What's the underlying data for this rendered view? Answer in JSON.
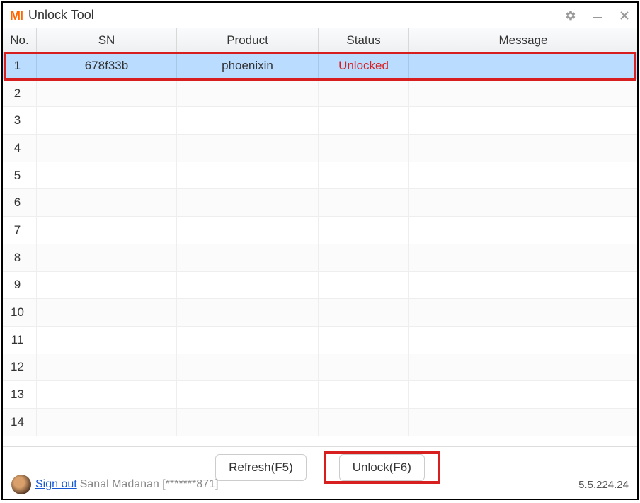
{
  "titlebar": {
    "logo": "MI",
    "title": "Unlock Tool",
    "icons": {
      "settings": "gear",
      "minimize": "minimize",
      "close": "close"
    }
  },
  "table": {
    "headers": {
      "no": "No.",
      "sn": "SN",
      "product": "Product",
      "status": "Status",
      "message": "Message"
    },
    "rows": [
      {
        "no": "1",
        "sn": "678f33b",
        "product": "phoenixin",
        "status": "Unlocked",
        "message": "",
        "highlighted": true
      },
      {
        "no": "2",
        "sn": "",
        "product": "",
        "status": "",
        "message": ""
      },
      {
        "no": "3",
        "sn": "",
        "product": "",
        "status": "",
        "message": ""
      },
      {
        "no": "4",
        "sn": "",
        "product": "",
        "status": "",
        "message": ""
      },
      {
        "no": "5",
        "sn": "",
        "product": "",
        "status": "",
        "message": ""
      },
      {
        "no": "6",
        "sn": "",
        "product": "",
        "status": "",
        "message": ""
      },
      {
        "no": "7",
        "sn": "",
        "product": "",
        "status": "",
        "message": ""
      },
      {
        "no": "8",
        "sn": "",
        "product": "",
        "status": "",
        "message": ""
      },
      {
        "no": "9",
        "sn": "",
        "product": "",
        "status": "",
        "message": ""
      },
      {
        "no": "10",
        "sn": "",
        "product": "",
        "status": "",
        "message": ""
      },
      {
        "no": "11",
        "sn": "",
        "product": "",
        "status": "",
        "message": ""
      },
      {
        "no": "12",
        "sn": "",
        "product": "",
        "status": "",
        "message": ""
      },
      {
        "no": "13",
        "sn": "",
        "product": "",
        "status": "",
        "message": ""
      },
      {
        "no": "14",
        "sn": "",
        "product": "",
        "status": "",
        "message": ""
      }
    ]
  },
  "footer": {
    "refresh_label": "Refresh(F5)",
    "unlock_label": "Unlock(F6)",
    "unlock_highlighted": true,
    "signout_link": "Sign out",
    "user_name": "Sanal Madanan [*******871]",
    "version": "5.5.224.24"
  }
}
